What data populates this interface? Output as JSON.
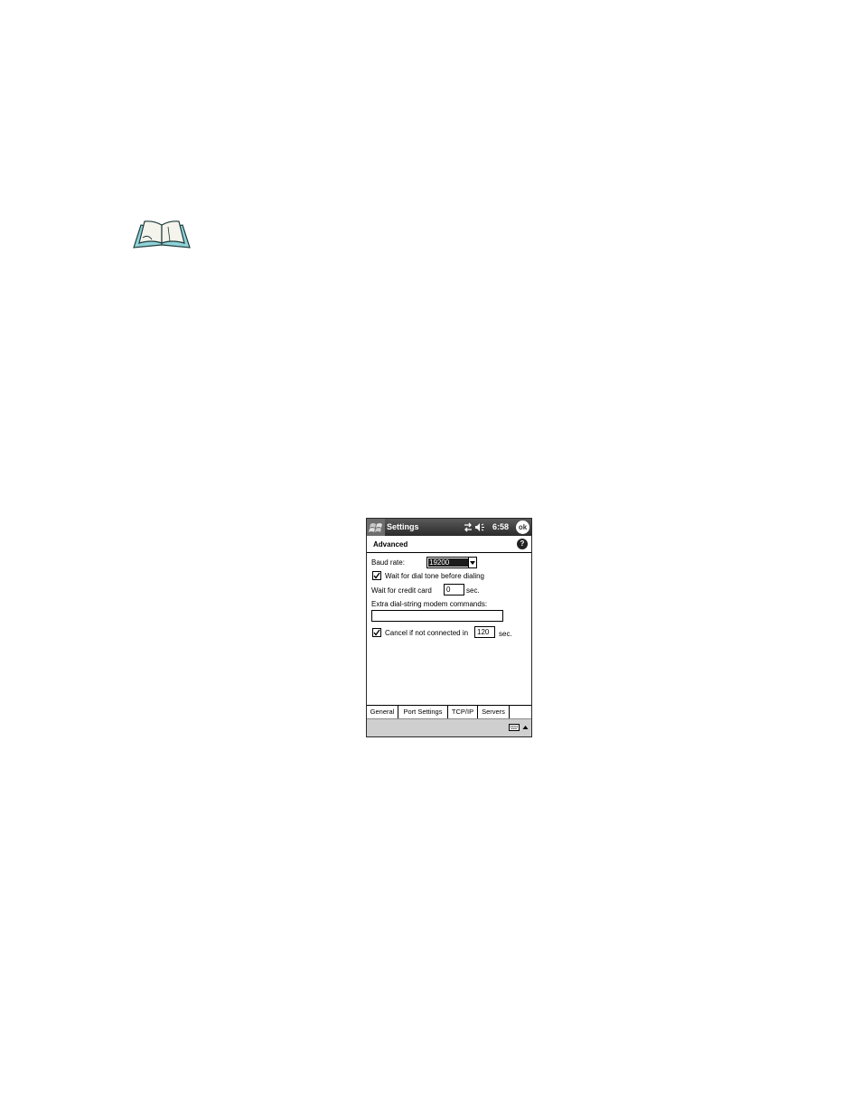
{
  "title_bar": {
    "app_title": "Settings",
    "time": "6:58",
    "ok_label": "ok"
  },
  "header": {
    "title": "Advanced",
    "help_label": "?"
  },
  "form": {
    "baud_label": "Baud rate:",
    "baud_value": "19200",
    "dial_tone_label": "Wait for dial tone before dialing",
    "dial_tone_checked": true,
    "credit_card_label": "Wait for credit card",
    "credit_card_value": "0",
    "credit_card_unit": "sec.",
    "extra_label": "Extra dial-string modem commands:",
    "extra_value": "",
    "cancel_label": "Cancel if not connected in",
    "cancel_checked": true,
    "cancel_value": "120",
    "cancel_unit": "sec."
  },
  "tabs": [
    {
      "label": "General",
      "active": true
    },
    {
      "label": "Port Settings",
      "active": false
    },
    {
      "label": "TCP/IP",
      "active": false
    },
    {
      "label": "Servers",
      "active": false
    }
  ],
  "icons": {
    "note": "open-book-icon",
    "start": "windows-flag-icon",
    "status": [
      "connectivity-icon",
      "volume-icon"
    ],
    "keyboard": "keyboard-icon",
    "sip_toggle": "up-arrow-icon"
  },
  "colors": {
    "title_bar": "#2b2b2b",
    "book_fill": "#8fd3d8",
    "menu_bar": "#cfcfcf"
  }
}
